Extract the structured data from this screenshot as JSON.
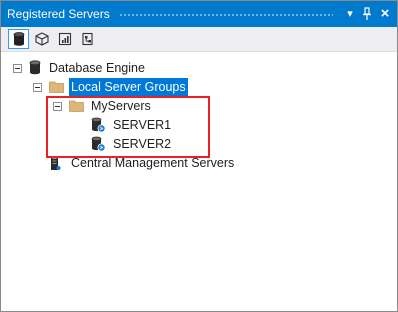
{
  "window": {
    "title": "Registered Servers",
    "colors": {
      "titlebar": "#007acc",
      "toolbar": "#eeeef2",
      "selection": "#0078d7",
      "highlight_border": "#e8202a"
    }
  },
  "titlebar_buttons": [
    {
      "name": "dropdown",
      "glyph": "▾",
      "icon": "chevron-down-icon"
    },
    {
      "name": "pin",
      "glyph": "╤",
      "icon": "pin-icon"
    },
    {
      "name": "close",
      "glyph": "×",
      "icon": "close-icon"
    }
  ],
  "toolbar": {
    "tools": [
      {
        "icon": "database-engine-icon",
        "active": true
      },
      {
        "icon": "analysis-services-icon",
        "active": false
      },
      {
        "icon": "reporting-services-icon",
        "active": false
      },
      {
        "icon": "integration-services-icon",
        "active": false
      }
    ]
  },
  "tree": {
    "database_engine": {
      "label": "Database Engine",
      "icon": "database-icon"
    },
    "local_server_groups": {
      "label": "Local Server Groups",
      "icon": "folder-icon",
      "selected": true
    },
    "my_servers": {
      "label": "MyServers",
      "icon": "folder-icon"
    },
    "servers": [
      {
        "label": "SERVER1",
        "icon": "server-icon"
      },
      {
        "label": "SERVER2",
        "icon": "server-icon"
      }
    ],
    "central_management": {
      "label": "Central Management Servers",
      "icon": "server-tower-icon"
    }
  }
}
